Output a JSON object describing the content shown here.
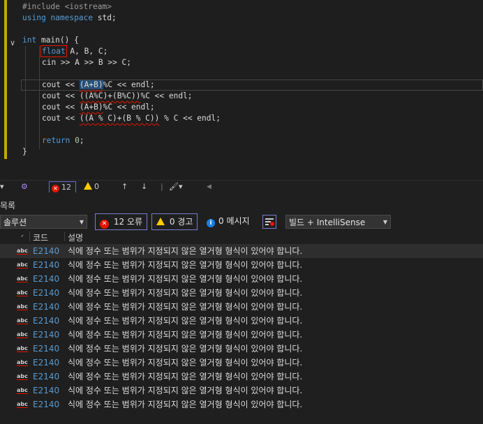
{
  "editor": {
    "lines": {
      "l1": "#include <iostream>",
      "l2_kw1": "using",
      "l2_kw2": "namespace",
      "l2_rest": " std;",
      "l4_kw": "int",
      "l4_rest": " main() {",
      "l5_kw": "float",
      "l5_rest": " A, B, C;",
      "l6": "cin >> A >> B >> C;",
      "l8_a": "cout << ",
      "l8_b": "(A+B)",
      "l8_c": "%C << endl;",
      "l9_a": "cout << ",
      "l9_b": "((A%C)+(B%C))",
      "l9_c": "%C << endl;",
      "l10_a": "cout << ",
      "l10_b": "(A+B)",
      "l10_c": "%C << endl;",
      "l11_a": "cout << ",
      "l11_b": "((A % C)+(B % C))",
      "l11_c": " % C << endl;",
      "l13_kw": "return",
      "l13_num": "0",
      "l13_end": ";",
      "l14": "}"
    }
  },
  "status": {
    "error_count": "12",
    "warning_count": "0",
    "up_arrow": "↑",
    "down_arrow": "↓",
    "left_arrow": "◀"
  },
  "error_list": {
    "title": "목록",
    "scope_dropdown": "솔루션",
    "errors_toggle": "12 오류",
    "warnings_toggle": "0 경고",
    "messages_toggle": "0 메시지",
    "source_dropdown": "빌드 + IntelliSense",
    "columns": {
      "code": "코드",
      "description": "설명"
    },
    "rows": [
      {
        "code": "E2140",
        "desc": "식에 정수 또는 범위가 지정되지 않은 열거형 형식이 있어야 합니다."
      },
      {
        "code": "E2140",
        "desc": "식에 정수 또는 범위가 지정되지 않은 열거형 형식이 있어야 합니다."
      },
      {
        "code": "E2140",
        "desc": "식에 정수 또는 범위가 지정되지 않은 열거형 형식이 있어야 합니다."
      },
      {
        "code": "E2140",
        "desc": "식에 정수 또는 범위가 지정되지 않은 열거형 형식이 있어야 합니다."
      },
      {
        "code": "E2140",
        "desc": "식에 정수 또는 범위가 지정되지 않은 열거형 형식이 있어야 합니다."
      },
      {
        "code": "E2140",
        "desc": "식에 정수 또는 범위가 지정되지 않은 열거형 형식이 있어야 합니다."
      },
      {
        "code": "E2140",
        "desc": "식에 정수 또는 범위가 지정되지 않은 열거형 형식이 있어야 합니다."
      },
      {
        "code": "E2140",
        "desc": "식에 정수 또는 범위가 지정되지 않은 열거형 형식이 있어야 합니다."
      },
      {
        "code": "E2140",
        "desc": "식에 정수 또는 범위가 지정되지 않은 열거형 형식이 있어야 합니다."
      },
      {
        "code": "E2140",
        "desc": "식에 정수 또는 범위가 지정되지 않은 열거형 형식이 있어야 합니다."
      },
      {
        "code": "E2140",
        "desc": "식에 정수 또는 범위가 지정되지 않은 열거형 형식이 있어야 합니다."
      },
      {
        "code": "E2140",
        "desc": "식에 정수 또는 범위가 지정되지 않은 열거형 형식이 있어야 합니다."
      }
    ],
    "row_icon": "abc"
  }
}
